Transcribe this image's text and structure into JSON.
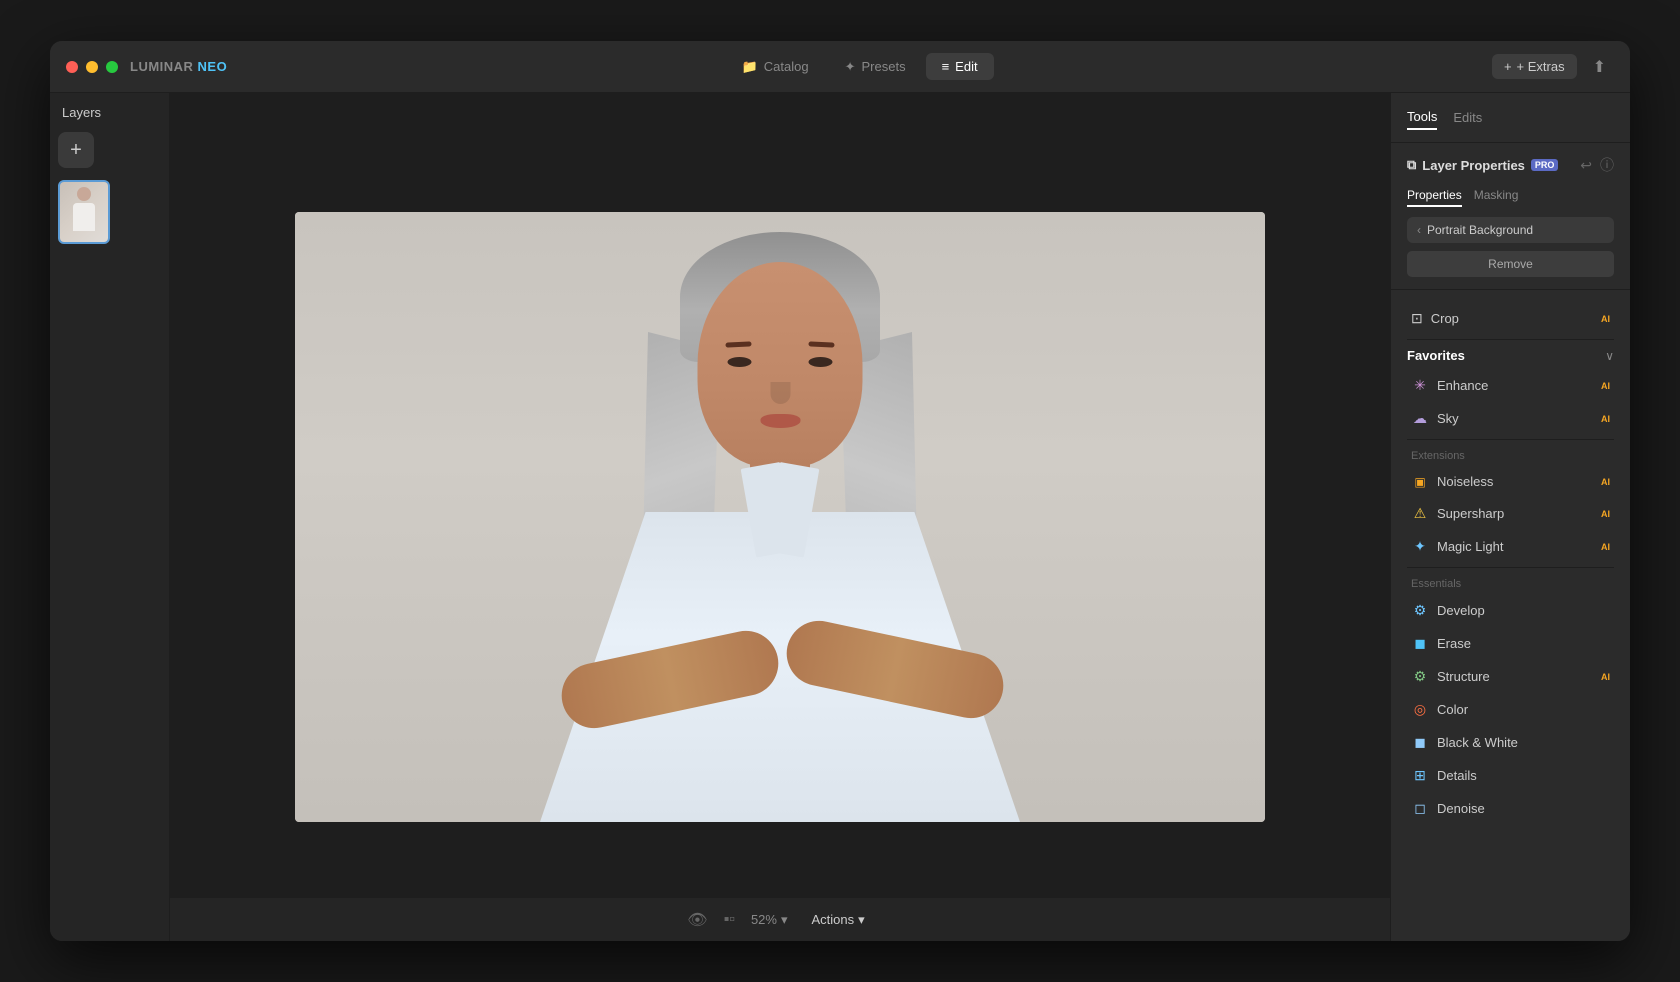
{
  "app": {
    "name": "LUMINAR",
    "name_colored": "NEO",
    "window_title": "LUMINAR NEO"
  },
  "traffic_lights": {
    "red": "#ff5f56",
    "yellow": "#ffbd2e",
    "green": "#27c93f"
  },
  "titlebar": {
    "tabs": [
      {
        "id": "catalog",
        "label": "Catalog",
        "icon": "📁",
        "active": false
      },
      {
        "id": "presets",
        "label": "Presets",
        "icon": "✦",
        "active": false
      },
      {
        "id": "edit",
        "label": "Edit",
        "icon": "≡",
        "active": true
      }
    ],
    "extras_label": "+ Extras",
    "export_icon": "⬆"
  },
  "layers_panel": {
    "header": "Layers",
    "add_button": "+",
    "layer_count": 1
  },
  "canvas": {
    "zoom": "52%",
    "zoom_chevron": "▾",
    "actions_label": "Actions",
    "actions_chevron": "▾"
  },
  "right_panel": {
    "tabs": [
      {
        "id": "tools",
        "label": "Tools",
        "active": true
      },
      {
        "id": "edits",
        "label": "Edits",
        "active": false
      }
    ],
    "layer_properties": {
      "title": "Layer Properties",
      "pro_badge": "PRO",
      "undo_icon": "↩",
      "info_icon": "ⓘ",
      "sub_tabs": [
        {
          "id": "properties",
          "label": "Properties",
          "active": true
        },
        {
          "id": "masking",
          "label": "Masking",
          "active": false
        }
      ],
      "portrait_background": {
        "chevron": "‹",
        "label": "Portrait Background"
      },
      "remove_button": "Remove"
    },
    "crop": {
      "icon": "⊡",
      "label": "Crop",
      "ai_badge": "AI"
    },
    "favorites": {
      "section_title": "Favorites",
      "chevron": "∨",
      "items": [
        {
          "id": "enhance",
          "label": "Enhance",
          "icon": "✳",
          "icon_color": "#ce93d8",
          "ai_badge": "AI"
        },
        {
          "id": "sky",
          "label": "Sky",
          "icon": "☁",
          "icon_color": "#b39ddb",
          "ai_badge": "AI"
        }
      ]
    },
    "extensions": {
      "section_title": "Extensions",
      "items": [
        {
          "id": "noiseless",
          "label": "Noiseless",
          "icon": "🟧",
          "icon_color": "#f5a623",
          "ai_badge": "AI"
        },
        {
          "id": "supersharp",
          "label": "Supersharp",
          "icon": "⚠",
          "icon_color": "#f5c842",
          "ai_badge": "AI"
        },
        {
          "id": "magic-light",
          "label": "Magic Light",
          "icon": "✦",
          "icon_color": "#6ec6ff",
          "ai_badge": "AI"
        }
      ]
    },
    "essentials": {
      "section_title": "Essentials",
      "items": [
        {
          "id": "develop",
          "label": "Develop",
          "icon": "⚙",
          "icon_color": "#6ec6ff"
        },
        {
          "id": "erase",
          "label": "Erase",
          "icon": "◼",
          "icon_color": "#4fc3f7"
        },
        {
          "id": "structure",
          "label": "Structure",
          "icon": "⚙",
          "icon_color": "#81c784",
          "ai_badge": "AI"
        },
        {
          "id": "color",
          "label": "Color",
          "icon": "◎",
          "icon_color": "#ff7043"
        },
        {
          "id": "bw",
          "label": "Black & White",
          "icon": "◼",
          "icon_color": "#90caf9"
        },
        {
          "id": "details",
          "label": "Details",
          "icon": "⊞",
          "icon_color": "#6ec6ff"
        },
        {
          "id": "denoise",
          "label": "Denoise",
          "icon": "◻",
          "icon_color": "#90caf9"
        }
      ]
    }
  }
}
